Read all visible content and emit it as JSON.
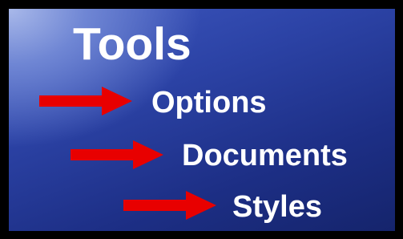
{
  "title": "Tools",
  "menu_path": [
    {
      "label": "Options",
      "icon": "arrow-right-icon"
    },
    {
      "label": "Documents",
      "icon": "arrow-right-icon"
    },
    {
      "label": "Styles",
      "icon": "arrow-right-icon"
    }
  ],
  "colors": {
    "frame": "#000000",
    "panel_top_left": "#a9b9ea",
    "panel_bottom_right": "#15246c",
    "text": "#ffffff",
    "arrow": "#e80000"
  }
}
